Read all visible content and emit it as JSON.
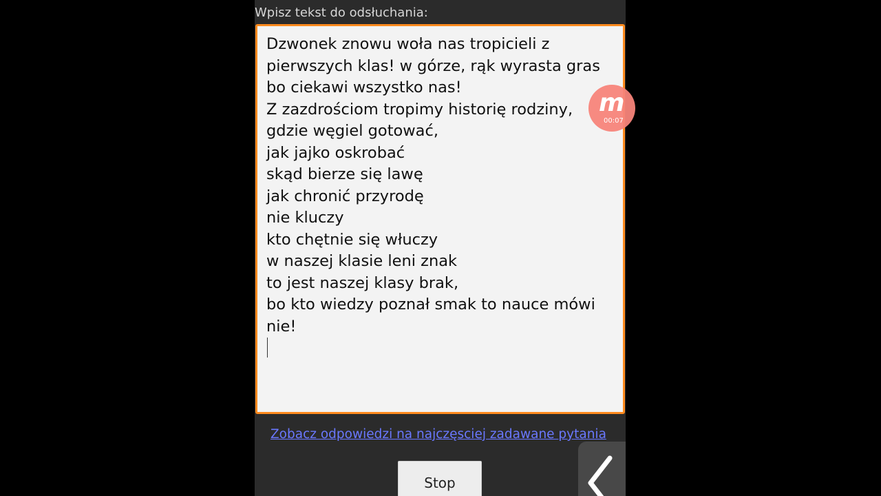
{
  "screen": {
    "prompt_label": "Wpisz tekst do odsłuchania:",
    "text_input": {
      "value": "Dzwonek znowu woła nas tropicieli z\npierwszych klas! w górze, rąk wyrasta gras\nbo ciekawi wszystko nas!\nZ zazdrościom tropimy historię rodziny,\ngdzie węgiel gotować,\njak jajko oskrobać\nskąd bierze się lawę\njak chronić przyrodę\nnie kluczy\nkto chętnie się włuczy\nw naszej klasie leni znak\nto jest naszej klasy brak,\nbo kto wiedzy poznał smak to nauce mówi\nnie!"
    },
    "faq_link": "Zobacz odpowiedzi na najczęsciej zadawane pytania",
    "stop_button": "Stop"
  },
  "recorder_overlay": {
    "glyph": "m",
    "elapsed": "00:07",
    "color": "#f7847a"
  },
  "icons": {
    "back": "chevron-left-icon"
  },
  "colors": {
    "accent_border": "#ff8a1d",
    "link": "#6a78ff",
    "background": "#2b2b2b"
  }
}
